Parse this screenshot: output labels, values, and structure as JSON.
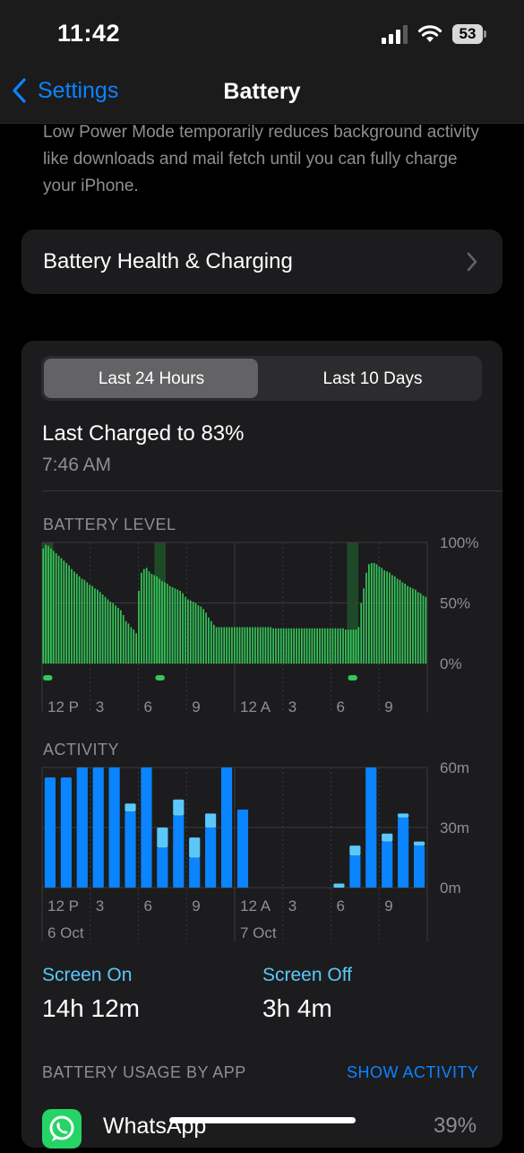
{
  "status": {
    "time": "11:42",
    "battery": "53"
  },
  "nav": {
    "back_label": "Settings",
    "title": "Battery"
  },
  "low_power_description": "Low Power Mode temporarily reduces background activity like downloads and mail fetch until you can fully charge your iPhone.",
  "health": {
    "label": "Battery Health & Charging"
  },
  "segment": {
    "options": [
      "Last 24 Hours",
      "Last 10 Days"
    ],
    "selected": "Last 24 Hours"
  },
  "last_charged": {
    "title": "Last Charged to 83%",
    "time": "7:46 AM"
  },
  "battery_level": {
    "title": "BATTERY LEVEL",
    "y_ticks": [
      "100%",
      "50%",
      "0%"
    ],
    "x_ticks": [
      "12 P",
      "3",
      "6",
      "9",
      "12 A",
      "3",
      "6",
      "9"
    ],
    "charging_windows_hours": [
      [
        0,
        0.7
      ],
      [
        7,
        7.7
      ],
      [
        19,
        19.7
      ]
    ],
    "levels": [
      95,
      98,
      97,
      95,
      93,
      91,
      89,
      87,
      85,
      83,
      81,
      78,
      76,
      74,
      72,
      70,
      69,
      67,
      65,
      64,
      62,
      61,
      59,
      57,
      55,
      53,
      51,
      50,
      48,
      46,
      44,
      40,
      35,
      33,
      30,
      28,
      25,
      60,
      75,
      78,
      79,
      76,
      74,
      73,
      72,
      70,
      68,
      67,
      66,
      64,
      63,
      62,
      61,
      60,
      58,
      55,
      53,
      52,
      51,
      50,
      48,
      47,
      45,
      42,
      38,
      35,
      32,
      30,
      30,
      30,
      30,
      30,
      30,
      30,
      30,
      30,
      30,
      30,
      30,
      30,
      30,
      30,
      30,
      30,
      30,
      30,
      30,
      30,
      30,
      29,
      29,
      29,
      29,
      29,
      29,
      29,
      29,
      29,
      29,
      29,
      29,
      29,
      29,
      29,
      29,
      29,
      29,
      29,
      29,
      29,
      29,
      29,
      29,
      29,
      29,
      29,
      29,
      28,
      28,
      28,
      28,
      28,
      30,
      50,
      62,
      75,
      82,
      83,
      83,
      82,
      80,
      79,
      77,
      76,
      75,
      73,
      72,
      70,
      69,
      67,
      66,
      64,
      63,
      62,
      61,
      59,
      58,
      56,
      55
    ]
  },
  "activity": {
    "title": "ACTIVITY",
    "y_ticks": [
      "60m",
      "30m",
      "0m"
    ],
    "x_ticks": [
      "12 P",
      "3",
      "6",
      "9",
      "12 A",
      "3",
      "6",
      "9"
    ],
    "dates": [
      "6 Oct",
      "7 Oct"
    ],
    "hours": [
      {
        "on": 55,
        "off": 0
      },
      {
        "on": 55,
        "off": 0
      },
      {
        "on": 60,
        "off": 0
      },
      {
        "on": 60,
        "off": 0
      },
      {
        "on": 60,
        "off": 0
      },
      {
        "on": 38,
        "off": 4
      },
      {
        "on": 60,
        "off": 0
      },
      {
        "on": 20,
        "off": 10
      },
      {
        "on": 36,
        "off": 8
      },
      {
        "on": 15,
        "off": 10
      },
      {
        "on": 30,
        "off": 7
      },
      {
        "on": 60,
        "off": 0
      },
      {
        "on": 39,
        "off": 0
      },
      {
        "on": 0,
        "off": 0
      },
      {
        "on": 0,
        "off": 0
      },
      {
        "on": 0,
        "off": 0
      },
      {
        "on": 0,
        "off": 0
      },
      {
        "on": 0,
        "off": 0
      },
      {
        "on": 0,
        "off": 2
      },
      {
        "on": 16,
        "off": 5
      },
      {
        "on": 60,
        "off": 0
      },
      {
        "on": 23,
        "off": 4
      },
      {
        "on": 35,
        "off": 2
      },
      {
        "on": 21,
        "off": 2
      }
    ]
  },
  "stats": {
    "screen_on_label": "Screen On",
    "screen_on_value": "14h 12m",
    "screen_off_label": "Screen Off",
    "screen_off_value": "3h 4m"
  },
  "usage": {
    "title": "BATTERY USAGE BY APP",
    "show_activity": "SHOW ACTIVITY",
    "apps": [
      {
        "name": "WhatsApp",
        "percent": "39%"
      }
    ]
  },
  "colors": {
    "accent": "#0a84ff",
    "battery_green": "#34c759",
    "charging_band": "#1e4a28",
    "screen_on": "#0a84ff",
    "screen_off": "#5ac8fa",
    "background": "#000000",
    "card": "#1c1c1e"
  }
}
